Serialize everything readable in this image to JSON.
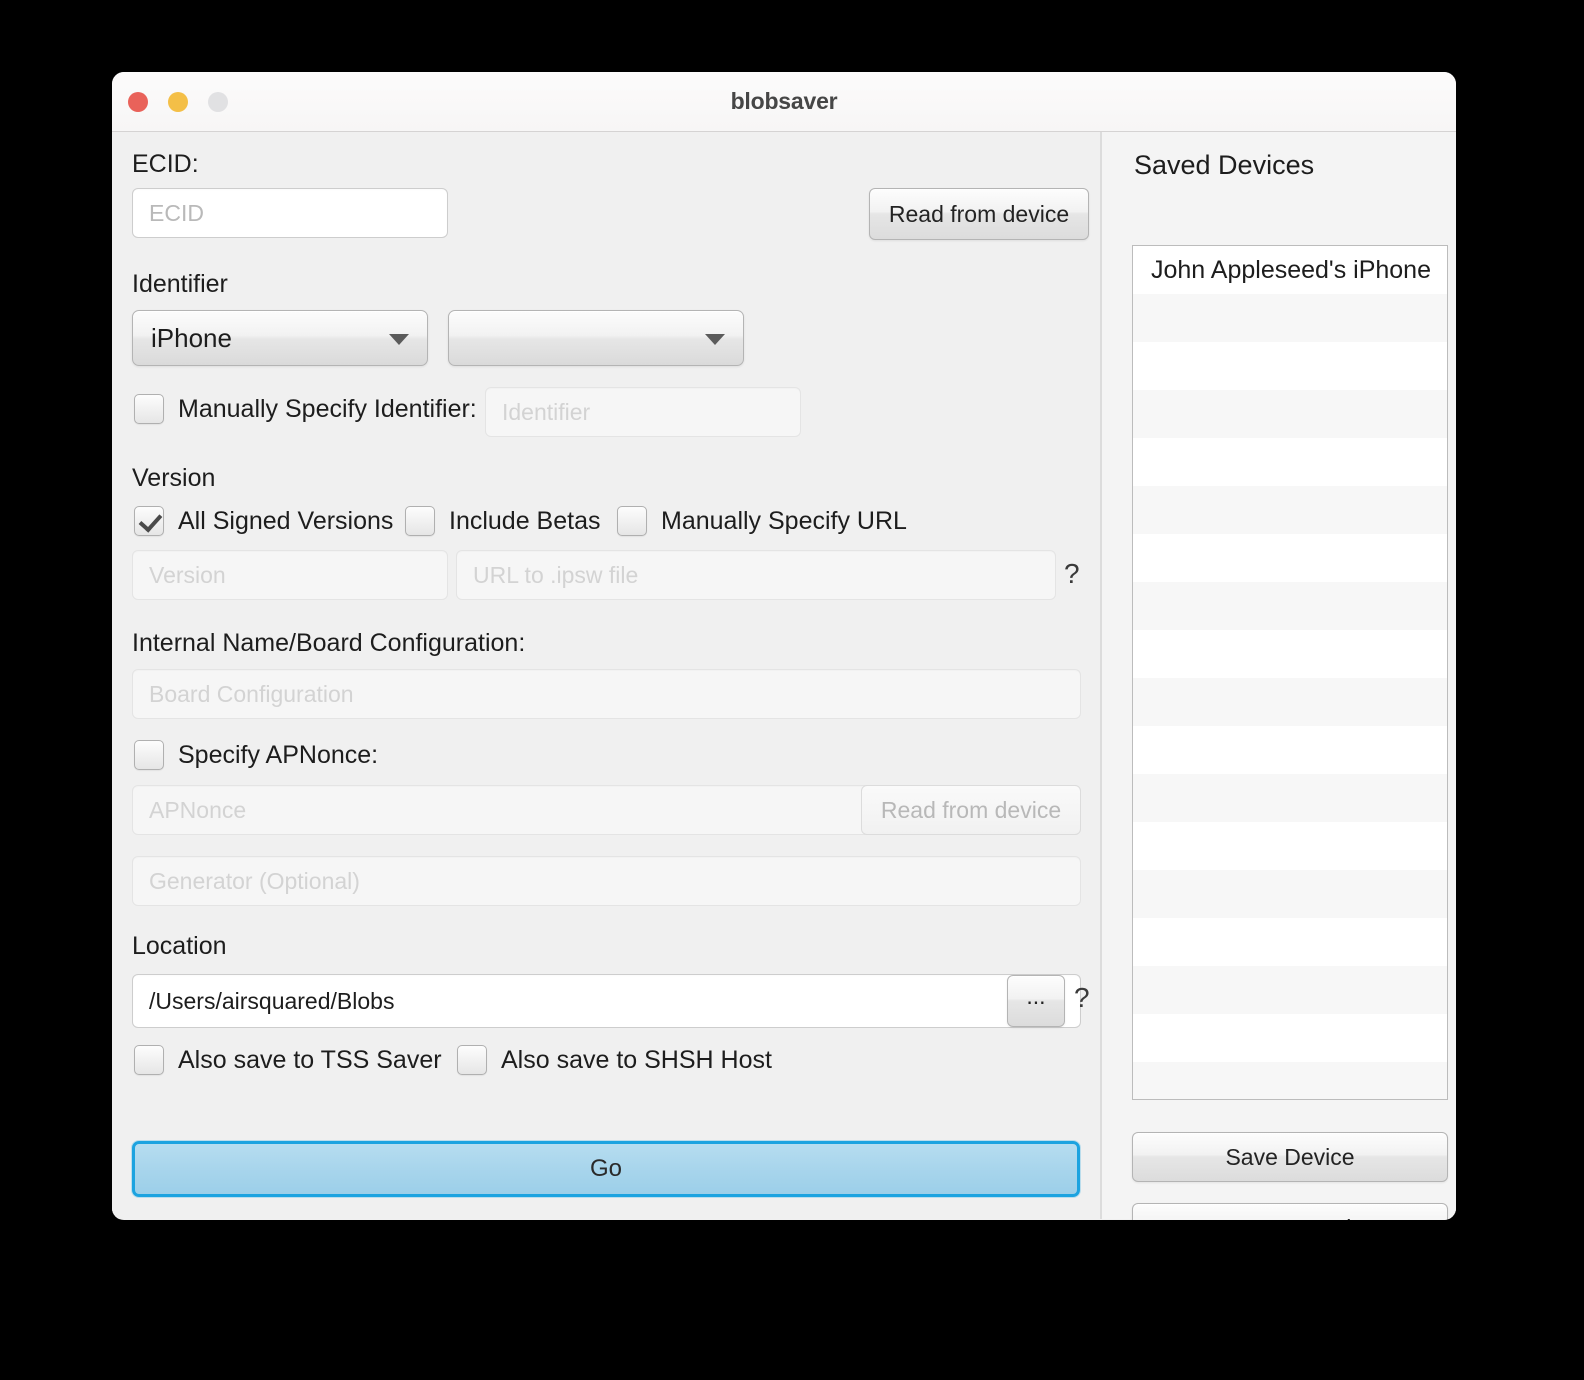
{
  "window": {
    "title": "blobsaver",
    "traffic_lights": {
      "close": "close-button",
      "minimize": "minimize-button",
      "maximize": "maximize-button"
    },
    "colors": {
      "close": "#e9625a",
      "minimize": "#f4bf47",
      "maximize": "#e1e1e3",
      "accent": "#1ca3e0",
      "go_fill": "#a8d5ec",
      "window_bg": "#f0f0f0",
      "sidebar_bg": "#f4f4f4"
    }
  },
  "main": {
    "ecid": {
      "label": "ECID:",
      "input_placeholder": "ECID",
      "input_value": "",
      "read_button": "Read from device"
    },
    "identifier": {
      "label": "Identifier",
      "device_type_value": "iPhone",
      "device_model_value": "",
      "manual_checkbox_label": "Manually Specify Identifier:",
      "manual_checked": false,
      "manual_input_placeholder": "Identifier",
      "manual_input_value": ""
    },
    "version": {
      "label": "Version",
      "checkboxes": [
        {
          "label": "All Signed Versions",
          "checked": true
        },
        {
          "label": "Include Betas",
          "checked": false
        },
        {
          "label": "Manually Specify URL",
          "checked": false
        }
      ],
      "version_placeholder": "Version",
      "version_value": "",
      "url_placeholder": "URL to .ipsw file",
      "url_value": "",
      "help_icon": "?"
    },
    "board": {
      "label": "Internal Name/Board Configuration:",
      "input_placeholder": "Board Configuration",
      "input_value": ""
    },
    "apnonce": {
      "checkbox_label": "Specify APNonce:",
      "checked": false,
      "apnonce_placeholder": "APNonce",
      "apnonce_value": "",
      "read_button": "Read from device",
      "generator_placeholder": "Generator (Optional)",
      "generator_value": ""
    },
    "location": {
      "label": "Location",
      "path_value": "/Users/airsquared/Blobs",
      "browse_button": "...",
      "help_icon": "?",
      "checkboxes": [
        {
          "label": "Also save to TSS Saver",
          "checked": false
        },
        {
          "label": "Also save to SHSH Host",
          "checked": false
        }
      ]
    },
    "go_button": "Go"
  },
  "sidebar": {
    "title": "Saved Devices",
    "devices": [
      "John Appleseed's iPhone"
    ],
    "empty_row_count": 17,
    "buttons": {
      "save_device": "Save Device",
      "auto_save_settings": "Auto-Save Settings"
    }
  }
}
